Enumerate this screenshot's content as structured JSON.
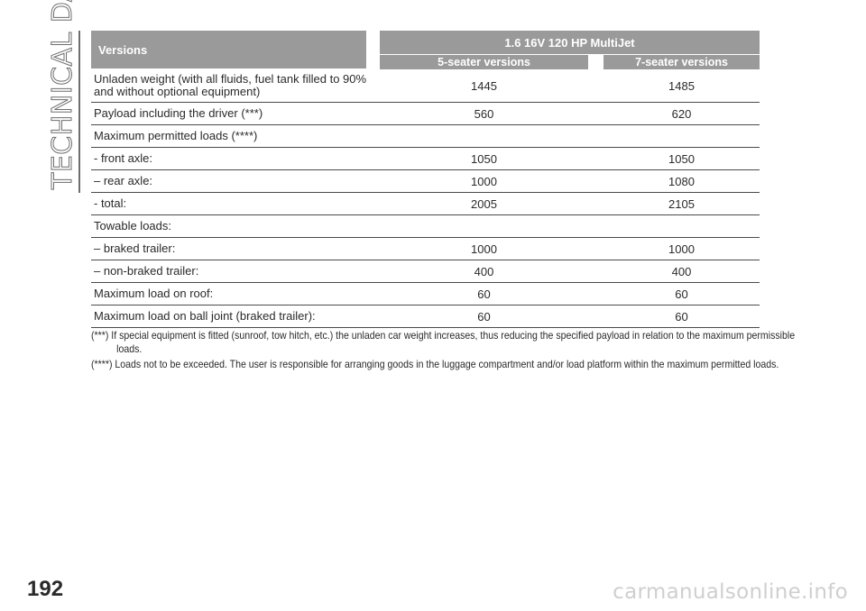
{
  "section_title": "TECHNICAL DATA",
  "page_number": "192",
  "watermark": "carmanualsonline.info",
  "table": {
    "header_versions": "Versions",
    "header_engine": "1.6 16V 120 HP MultiJet",
    "header_col1": "5-seater versions",
    "header_col2": "7-seater versions",
    "rows": [
      {
        "label": "Unladen weight (with all fluids, fuel tank filled to 90% and without optional equipment)",
        "v1": "1445",
        "v2": "1485"
      },
      {
        "label": "Payload including the driver (***)",
        "v1": "560",
        "v2": "620"
      },
      {
        "label": "Maximum permitted loads (****)",
        "v1": "",
        "v2": ""
      },
      {
        "label": "- front axle:",
        "v1": "1050",
        "v2": "1050"
      },
      {
        "label": "– rear axle:",
        "v1": "1000",
        "v2": "1080"
      },
      {
        "label": "- total:",
        "v1": "2005",
        "v2": "2105"
      },
      {
        "label": "Towable loads:",
        "v1": "",
        "v2": ""
      },
      {
        "label": "– braked trailer:",
        "v1": "1000",
        "v2": "1000"
      },
      {
        "label": "– non-braked trailer:",
        "v1": "400",
        "v2": "400"
      },
      {
        "label": "Maximum load on roof:",
        "v1": "60",
        "v2": "60"
      },
      {
        "label": "Maximum load on ball joint (braked trailer):",
        "v1": "60",
        "v2": "60"
      }
    ]
  },
  "notes": [
    "(***) If special equipment is fitted (sunroof, tow hitch, etc.) the unladen car weight increases, thus reducing the specified payload in relation to the maximum permissible loads.",
    "(****) Loads not to be exceeded. The user is responsible for arranging goods in the luggage compartment and/or load platform within the maximum permitted loads."
  ]
}
